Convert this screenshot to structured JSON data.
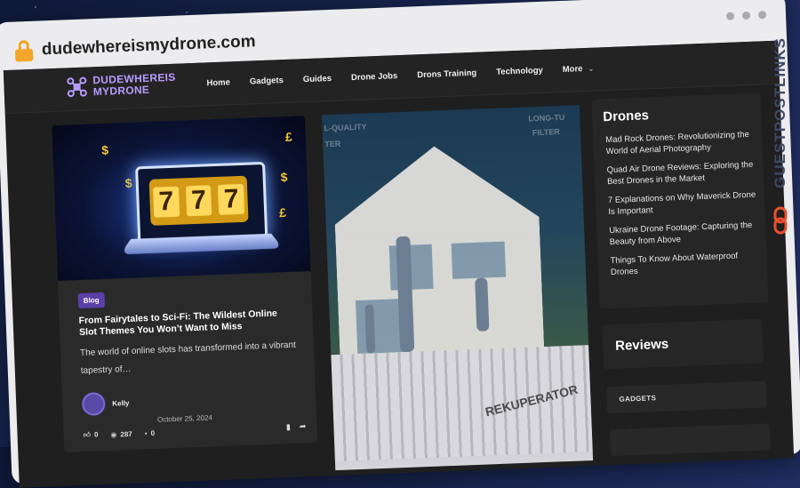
{
  "browser": {
    "url": "dudewhereismydrone.com"
  },
  "brand": {
    "line1": "DUDEWHEREIS",
    "line2": "MYDRONE",
    "accent": "#b79cff"
  },
  "nav": {
    "items": [
      "Home",
      "Gadgets",
      "Guides",
      "Drone Jobs",
      "Drons Training",
      "Technology"
    ],
    "more": "More"
  },
  "card": {
    "slot_symbols": [
      "7",
      "7",
      "7"
    ],
    "coins": [
      "$",
      "£",
      "$",
      "£",
      "$",
      "£"
    ],
    "badge": "Blog",
    "title": "From Fairytales to Sci-Fi: The Wildest Online Slot Themes You Won’t Want to Miss",
    "excerpt": "The world of online slots has transformed into a vibrant tapestry of…",
    "author": "Kelly",
    "date": "October 25, 2024",
    "likes": "0",
    "views": "287",
    "comments": "0"
  },
  "hero": {
    "word": "REKUPERATOR",
    "ghost1": "L-QUALITY",
    "ghost2": "TER",
    "ghost3": "LONG-TU",
    "ghost4": "FILTER"
  },
  "sidebar": {
    "heading": "Drones",
    "items": [
      "Mad Rock Drones: Revolutionizing the World of Aerial Photography",
      "Quad Air Drone Reviews: Exploring the Best Drones in the Market",
      "7 Explanations on Why Maverick Drone Is Important",
      "Ukraine Drone Footage: Capturing the Beauty from Above",
      "Things To Know About Waterproof Drones"
    ]
  },
  "reviews": {
    "heading": "Reviews"
  },
  "gadgets": {
    "label": "GADGETS"
  },
  "watermark": {
    "text": "GUESTPOSTLINKS"
  }
}
